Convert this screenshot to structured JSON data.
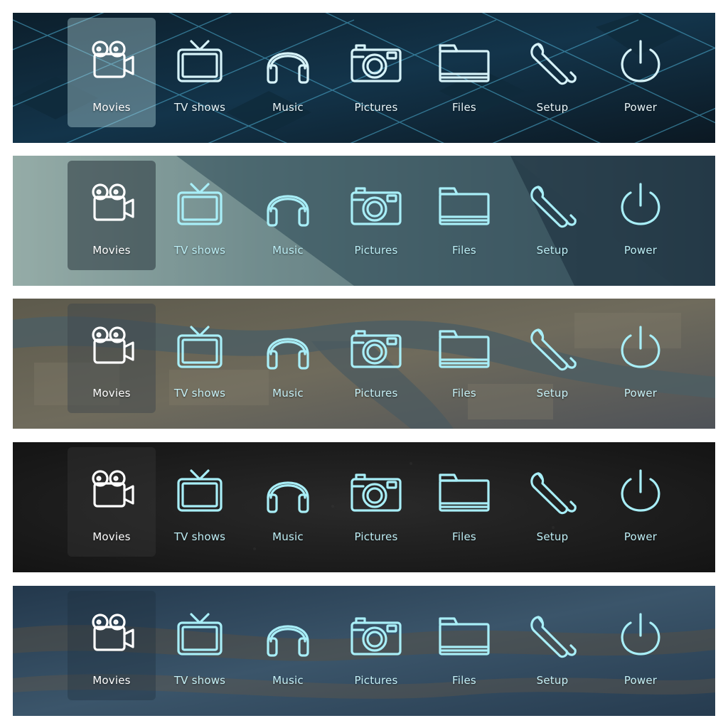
{
  "menu_items": [
    {
      "key": "movies",
      "label": "Movies",
      "icon": "movie-camera-icon"
    },
    {
      "key": "tv-shows",
      "label": "TV shows",
      "icon": "tv-icon"
    },
    {
      "key": "music",
      "label": "Music",
      "icon": "headphones-icon"
    },
    {
      "key": "pictures",
      "label": "Pictures",
      "icon": "camera-icon"
    },
    {
      "key": "files",
      "label": "Files",
      "icon": "folder-icon"
    },
    {
      "key": "setup",
      "label": "Setup",
      "icon": "wrench-icon"
    },
    {
      "key": "power",
      "label": "Power",
      "icon": "power-icon"
    }
  ],
  "variants": [
    {
      "theme": "blue-cubes",
      "selected": "movies",
      "selected_color": "#ffffff",
      "icon_color": "#d6f2f8",
      "text_color": "#e9f6fa",
      "highlight": "rgba(190,225,232,0.38)"
    },
    {
      "theme": "concrete",
      "selected": "movies",
      "selected_color": "#ffffff",
      "icon_color": "#a8eef7",
      "text_color": "#bdeff6",
      "highlight": "rgba(40,52,60,0.55)"
    },
    {
      "theme": "aerial-city",
      "selected": "movies",
      "selected_color": "#ffffff",
      "icon_color": "#a8eef7",
      "text_color": "#c6f0f6",
      "highlight": "rgba(60,68,76,0.45)"
    },
    {
      "theme": "dark-asphalt",
      "selected": "movies",
      "selected_color": "#ffffff",
      "icon_color": "#a8eef7",
      "text_color": "#bfeff6",
      "highlight": "rgba(60,60,60,0.35)"
    },
    {
      "theme": "rock",
      "selected": "movies",
      "selected_color": "#ffffff",
      "icon_color": "#a8eef7",
      "text_color": "#c6f1f7",
      "highlight": "rgba(30,45,60,0.35)"
    }
  ]
}
